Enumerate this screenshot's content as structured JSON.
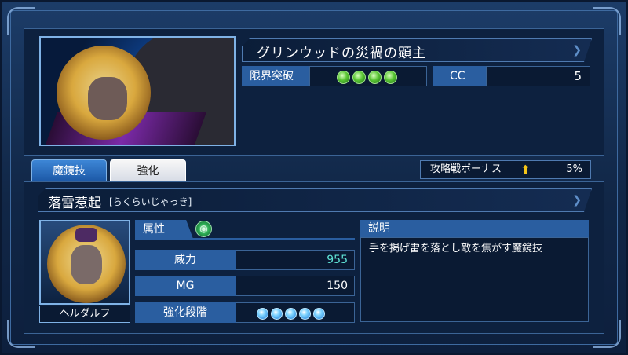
{
  "card": {
    "title": "グリンウッドの災禍の顕主",
    "limit_break_label": "限界突破",
    "limit_break_gems": 4,
    "cc_label": "CC",
    "cc_value": "5"
  },
  "tabs": {
    "magic_mirror": "魔鏡技",
    "enhance": "強化"
  },
  "bonus": {
    "label": "攻略戦ボーナス",
    "value": "5%"
  },
  "skill": {
    "name": "落雷惹起",
    "reading": "[らくらいじゃっき]",
    "character_name": "ヘルダルフ",
    "attribute_label": "属性",
    "power_label": "威力",
    "power_value": "955",
    "mg_label": "MG",
    "mg_value": "150",
    "enhance_stage_label": "強化段階",
    "enhance_stage_orbs": 5,
    "description_label": "説明",
    "description": "手を掲げ雷を落とし敵を焦がす魔鏡技"
  },
  "colors": {
    "panel": "#0d213f",
    "label_blue": "#2a5ea0",
    "power_text": "#5fe3d5"
  }
}
